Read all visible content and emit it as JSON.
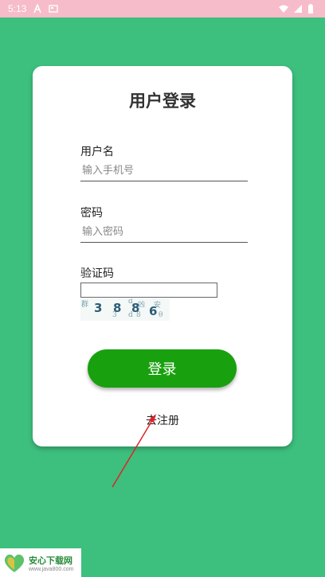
{
  "status_bar": {
    "time": "5:13",
    "left_icons": [
      "a-icon",
      "image-icon"
    ],
    "right_icons": [
      "wifi-icon",
      "signal-icon",
      "battery-icon"
    ],
    "background": "#f7bcc9"
  },
  "login": {
    "title": "用户登录",
    "username": {
      "label": "用户名",
      "placeholder": "输入手机号",
      "value": ""
    },
    "password": {
      "label": "密码",
      "placeholder": "输入密码",
      "value": ""
    },
    "captcha": {
      "label": "验证码",
      "value": "",
      "code_shown": [
        "3",
        "8",
        "8",
        "6"
      ]
    },
    "login_button": "登录",
    "register_link": "去注册"
  },
  "watermark": {
    "name": "安心下载网",
    "url": "www.java800.com"
  },
  "colors": {
    "background": "#3dbf7e",
    "button": "#18a00f",
    "card": "#ffffff",
    "annotation_arrow": "#e0222a"
  }
}
